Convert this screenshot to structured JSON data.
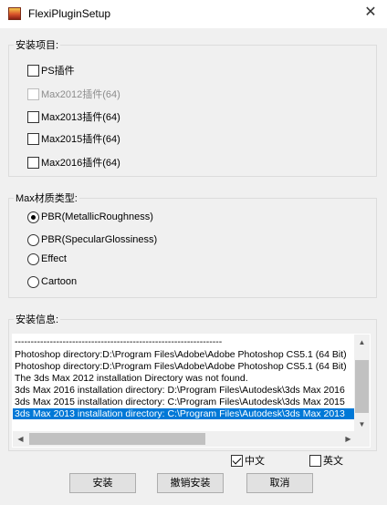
{
  "window": {
    "title": "FlexiPluginSetup",
    "close_glyph": "✕"
  },
  "install_items": {
    "legend": "安装项目:",
    "items": [
      {
        "label": "PS插件",
        "checked": false,
        "disabled": false
      },
      {
        "label": "Max2012插件(64)",
        "checked": false,
        "disabled": true
      },
      {
        "label": "Max2013插件(64)",
        "checked": false,
        "disabled": false
      },
      {
        "label": "Max2015插件(64)",
        "checked": false,
        "disabled": false
      },
      {
        "label": "Max2016插件(64)",
        "checked": false,
        "disabled": false
      }
    ]
  },
  "material_type": {
    "legend": "Max材质类型:",
    "options": [
      {
        "label": "PBR(MetallicRoughness)",
        "selected": true
      },
      {
        "label": "PBR(SpecularGlossiness)",
        "selected": false
      },
      {
        "label": "Effect",
        "selected": false
      },
      {
        "label": "Cartoon",
        "selected": false
      }
    ]
  },
  "install_info": {
    "legend": "安装信息:",
    "lines": [
      "-----------------------------------------------------------------",
      "Photoshop directory:D:\\Program Files\\Adobe\\Adobe Photoshop CS5.1 (64 Bit)",
      "Photoshop directory:D:\\Program Files\\Adobe\\Adobe Photoshop CS5.1 (64 Bit)",
      "The 3ds Max 2012 installation Directory was not found.",
      "3ds Max 2016 installation directory: D:\\Program Files\\Autodesk\\3ds Max 2016",
      "3ds Max 2015 installation directory: C:\\Program Files\\Autodesk\\3ds Max 2015",
      "3ds Max 2013 installation directory: C:\\Program Files\\Autodesk\\3ds Max 2013"
    ],
    "selected_line_index": 6
  },
  "language": {
    "chinese_label": "中文",
    "chinese_checked": true,
    "english_label": "英文",
    "english_checked": false
  },
  "buttons": {
    "install": "安装",
    "uninstall": "撤销安装",
    "cancel": "取消"
  }
}
